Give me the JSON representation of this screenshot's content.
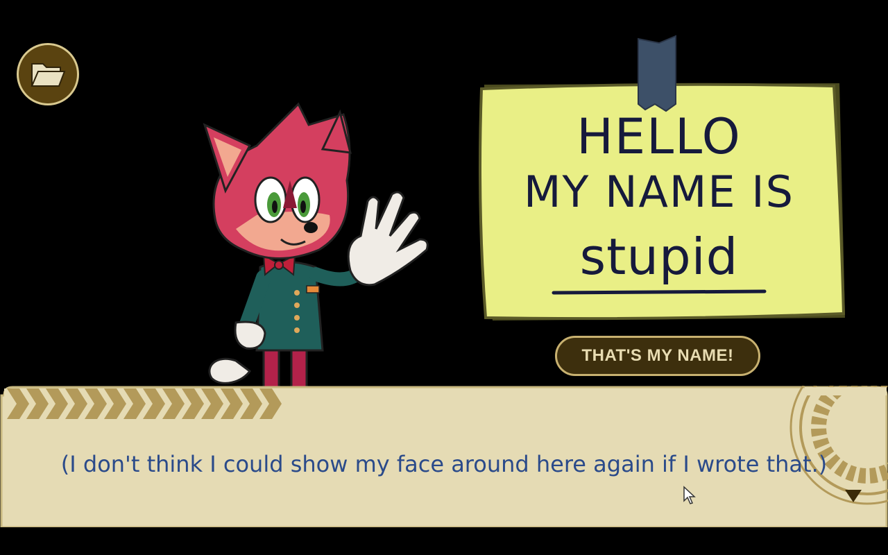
{
  "toolbar": {
    "folder_icon": "folder-icon"
  },
  "sign": {
    "line1": "HELLO",
    "line2": "MY NAME IS",
    "line3": "stupid"
  },
  "choice": {
    "label": "THAT'S MY NAME!"
  },
  "dialog": {
    "text": "(I don't think I could show my face around here again if I wrote that.)",
    "advance_icon": "triangle-down-icon"
  },
  "colors": {
    "background": "#000000",
    "dialog_bg": "#e5dbb4",
    "dialog_accent": "#b39a5a",
    "dialog_text": "#2a4a8a",
    "note_bg": "#e9ef86",
    "note_ink": "#161a3c",
    "button_bg": "#3d2f0d",
    "button_text": "#e8dcb2"
  }
}
